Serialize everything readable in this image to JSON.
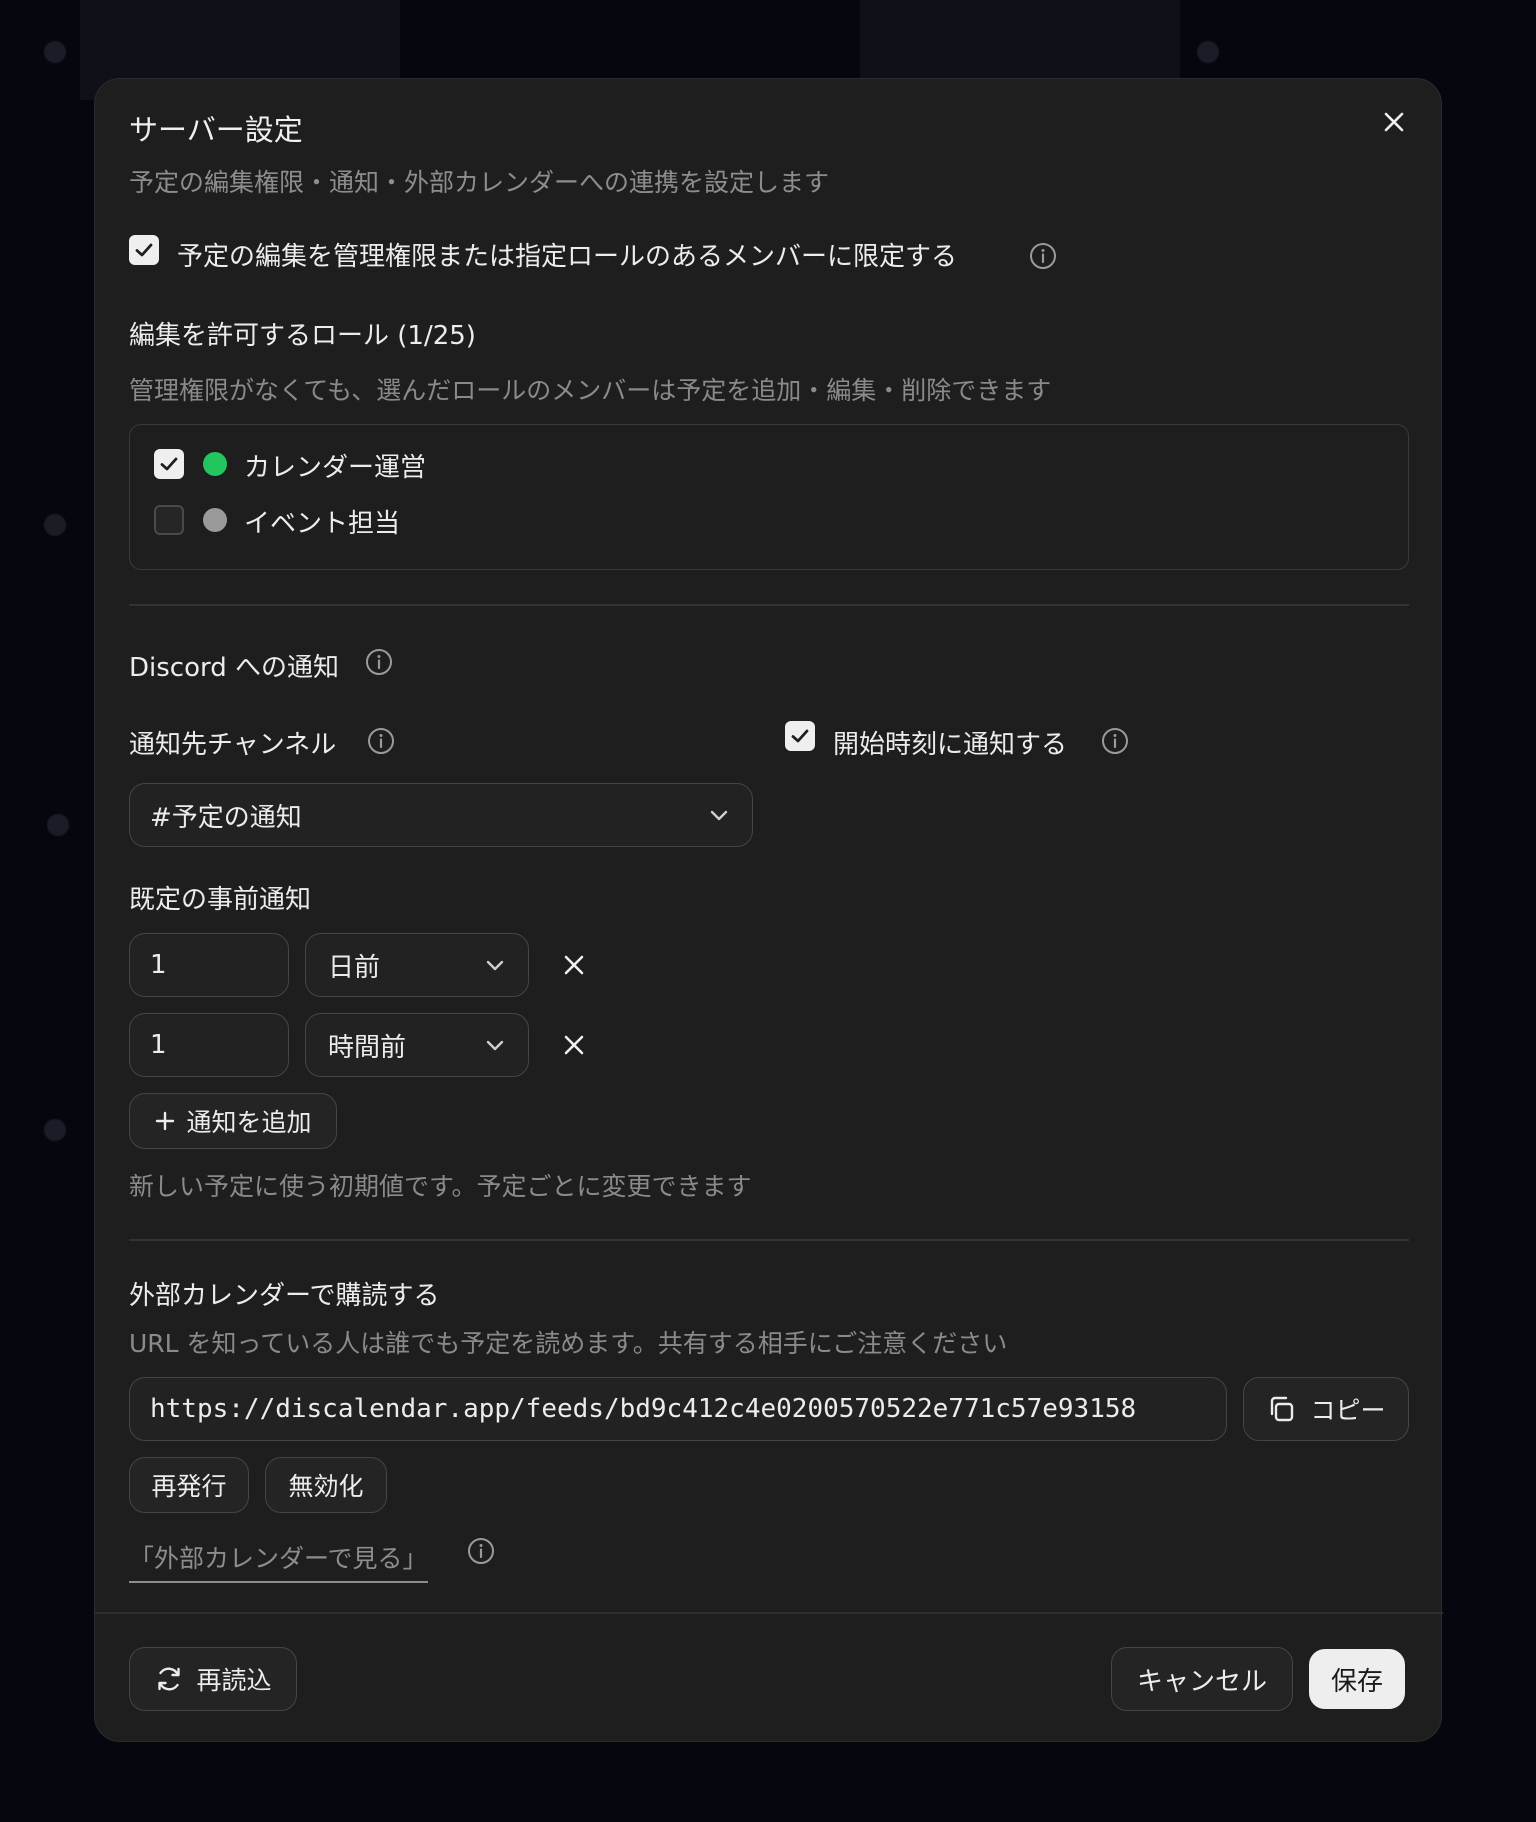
{
  "dialog": {
    "title": "サーバー設定",
    "description": "予定の編集権限・通知・外部カレンダーへの連携を設定します"
  },
  "permissions": {
    "restrict_label": "予定の編集を管理権限または指定ロールのあるメンバーに限定する",
    "restrict_checked": true,
    "roles_heading": "編集を許可するロール (1/25)",
    "roles_help": "管理権限がなくても、選んだロールのメンバーは予定を追加・編集・削除できます",
    "roles": [
      {
        "name": "カレンダー運営",
        "checked": true,
        "color": "#22c55e"
      },
      {
        "name": "イベント担当",
        "checked": false,
        "color": "#9a9a9a"
      }
    ]
  },
  "discord": {
    "heading": "Discord への通知",
    "channel_label": "通知先チャンネル",
    "channel_value": "#予定の通知",
    "start_notify_label": "開始時刻に通知する",
    "start_notify_checked": true,
    "reminders_label": "既定の事前通知",
    "reminders": [
      {
        "amount": "1",
        "unit": "日前"
      },
      {
        "amount": "1",
        "unit": "時間前"
      }
    ],
    "add_label": "通知を追加",
    "reminders_help": "新しい予定に使う初期値です。予定ごとに変更できます"
  },
  "external": {
    "heading": "外部カレンダーで購読する",
    "help": "URL を知っている人は誰でも予定を読めます。共有する相手にご注意ください",
    "url": "https://discalendar.app/feeds/bd9c412c4e0200570522e771c57e93158",
    "copy_label": "コピー",
    "reissue_label": "再発行",
    "disable_label": "無効化",
    "view_link": "「外部カレンダーで見る」"
  },
  "footer": {
    "reload_label": "再読込",
    "cancel_label": "キャンセル",
    "save_label": "保存"
  },
  "icons": {
    "close": "close-icon",
    "check": "check-icon",
    "info": "info-icon",
    "chevron": "chevron-down-icon",
    "remove": "x-icon",
    "plus": "plus-icon",
    "copy": "copy-icon",
    "reload": "refresh-icon"
  },
  "colors": {
    "dialog_bg": "#1e1e1e",
    "role_green": "#22c55e",
    "role_gray": "#9a9a9a",
    "primary_button": "#eeeeee"
  }
}
